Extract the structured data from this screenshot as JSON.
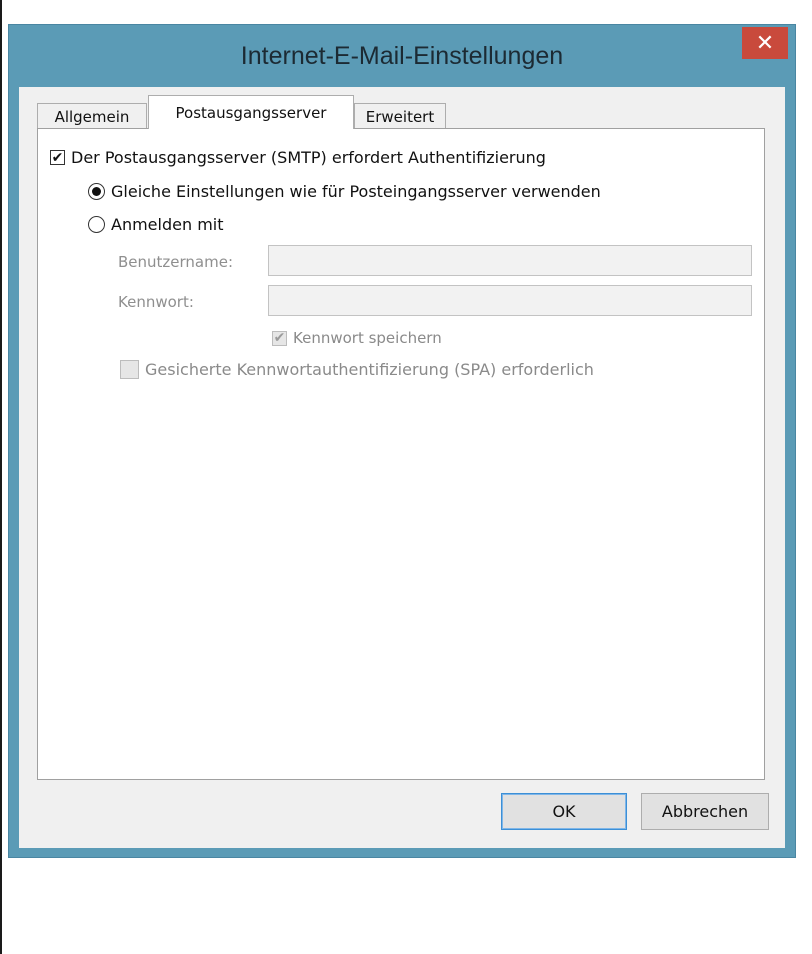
{
  "window": {
    "title": "Internet-E-Mail-Einstellungen",
    "close_glyph": "✕"
  },
  "tabs": [
    {
      "label": "Allgemein",
      "active": false
    },
    {
      "label": "Postausgangsserver",
      "active": true
    },
    {
      "label": "Erweitert",
      "active": false
    }
  ],
  "outgoing": {
    "smtp_auth_label": "Der Postausgangsserver (SMTP) erfordert Authentifizierung",
    "smtp_auth_checked": true,
    "radio_same_label": "Gleiche Einstellungen wie für Posteingangsserver verwenden",
    "radio_same_selected": true,
    "radio_login_label": "Anmelden mit",
    "radio_login_selected": false,
    "username_label": "Benutzername:",
    "username_value": "",
    "password_label": "Kennwort:",
    "password_value": "",
    "remember_password_label": "Kennwort speichern",
    "remember_password_checked": true,
    "spa_label": "Gesicherte Kennwortauthentifizierung (SPA) erforderlich",
    "spa_checked": false
  },
  "buttons": {
    "ok_label": "OK",
    "cancel_label": "Abbrechen"
  },
  "icons": {
    "check": "check-icon",
    "close": "close-icon"
  },
  "colors": {
    "titlebar": "#5b9bb6",
    "close": "#c94a3c",
    "default_button_border": "#3c8fd6"
  }
}
